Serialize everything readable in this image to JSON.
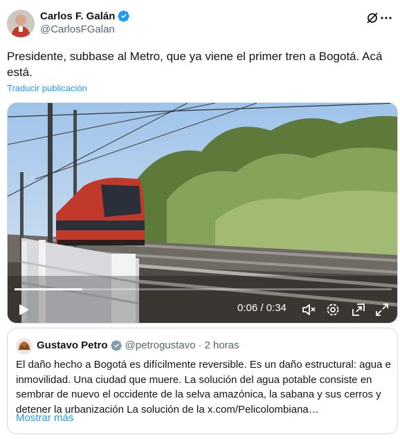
{
  "author": {
    "display_name": "Carlos F. Galán",
    "handle": "@CarlosFGalan"
  },
  "tweet": {
    "text": "Presidente, subbase al Metro, que ya viene el primer tren a Bogotá. Acá está.",
    "translate_label": "Traducir publicación"
  },
  "video": {
    "time": "0:06 / 0:34",
    "progress_fraction": 0.18
  },
  "quoted": {
    "display_name": "Gustavo Petro",
    "handle": "@petrogustavo",
    "separator": "·",
    "age": "2 horas",
    "text": "El daño hecho a Bogotá es difícilmente reversible. Es un daño estructural: agua e inmovilidad. Una ciudad que muere. La solución del agua potable consiste en sembrar de nuevo el occidente de la selva amazónica, la sabana y sus cerros y detener la urbanización La solución de la x.com/Pelicolombiana…",
    "show_more": "Mostrar más"
  },
  "colors": {
    "accent": "#1d9bf0",
    "secondary_text": "#536471",
    "border": "#cfd9de"
  }
}
